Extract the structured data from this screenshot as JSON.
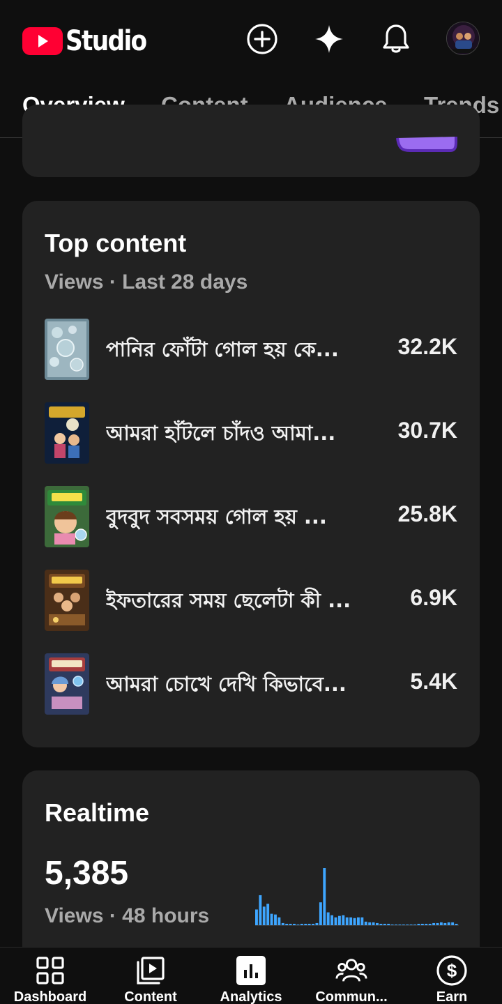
{
  "app": {
    "name": "Studio",
    "colors": {
      "brand_red": "#ff0033",
      "background": "#0f0f0f",
      "card": "#222222",
      "accent_blue": "#3ea6ff"
    }
  },
  "header": {
    "icons": [
      "create-icon",
      "sparkle-icon",
      "notifications-icon",
      "avatar"
    ]
  },
  "tabs": [
    {
      "label": "Overview",
      "active": true
    },
    {
      "label": "Content",
      "active": false
    },
    {
      "label": "Audience",
      "active": false
    },
    {
      "label": "Trends",
      "active": false
    }
  ],
  "top_content": {
    "title": "Top content",
    "subtitle": "Views · Last 28 days",
    "items": [
      {
        "title": "পানির ফোঁটা গোল হয় কে...",
        "views": "32.2K"
      },
      {
        "title": "আমরা হাঁটলে চাঁদও আমা...",
        "views": "30.7K"
      },
      {
        "title": "বুদবুদ সবসময় গোল হয় ...",
        "views": "25.8K"
      },
      {
        "title": "ইফতারের সময় ছেলেটা কী ...",
        "views": "6.9K"
      },
      {
        "title": "আমরা চোখে দেখি কিভাবে...",
        "views": "5.4K"
      }
    ]
  },
  "realtime": {
    "title": "Realtime",
    "views": "5,385",
    "subtitle": "Views · 48 hours",
    "bars": [
      22,
      42,
      26,
      30,
      16,
      15,
      11,
      3,
      2,
      2,
      2,
      1,
      2,
      2,
      2,
      2,
      3,
      32,
      80,
      18,
      14,
      11,
      13,
      14,
      11,
      11,
      10,
      11,
      11,
      5,
      4,
      4,
      3,
      2,
      2,
      2,
      1,
      1,
      1,
      1,
      1,
      1,
      1,
      2,
      2,
      2,
      2,
      3,
      3,
      4,
      3,
      4,
      4,
      2
    ]
  },
  "bottom_nav": [
    {
      "label": "Dashboard",
      "icon": "dashboard-icon"
    },
    {
      "label": "Content",
      "icon": "content-icon"
    },
    {
      "label": "Analytics",
      "icon": "analytics-icon",
      "active": true
    },
    {
      "label": "Commun...",
      "icon": "community-icon"
    },
    {
      "label": "Earn",
      "icon": "earn-icon"
    }
  ]
}
